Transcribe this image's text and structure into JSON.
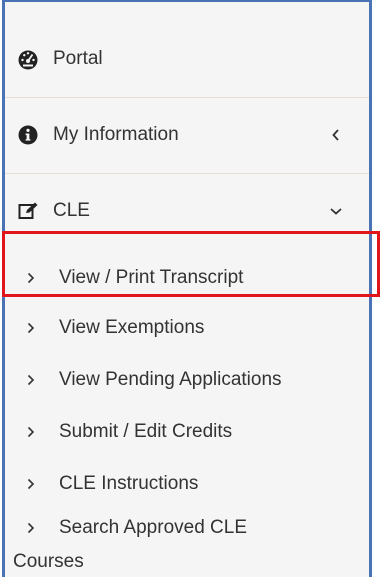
{
  "menu": {
    "portal": {
      "label": "Portal",
      "icon": "dashboard-icon"
    },
    "my_information": {
      "label": "My Information",
      "icon": "info-circle-icon",
      "chevron": "chevron-left-icon"
    },
    "cle": {
      "label": "CLE",
      "icon": "edit-icon",
      "chevron": "chevron-down-icon"
    },
    "cle_items": [
      {
        "label": "View / Print Transcript",
        "highlighted": true
      },
      {
        "label": "View Exemptions"
      },
      {
        "label": "View Pending Applications"
      },
      {
        "label": "Submit / Edit Credits"
      },
      {
        "label": "CLE Instructions"
      }
    ],
    "search_courses": {
      "line1": "Search Approved CLE",
      "line2": "Courses"
    }
  },
  "colors": {
    "panel_border": "#4a73b5",
    "highlight": "#e0161c",
    "panel_background": "#f5f5f5",
    "divider": "#e6dfd3",
    "text": "#333333"
  }
}
